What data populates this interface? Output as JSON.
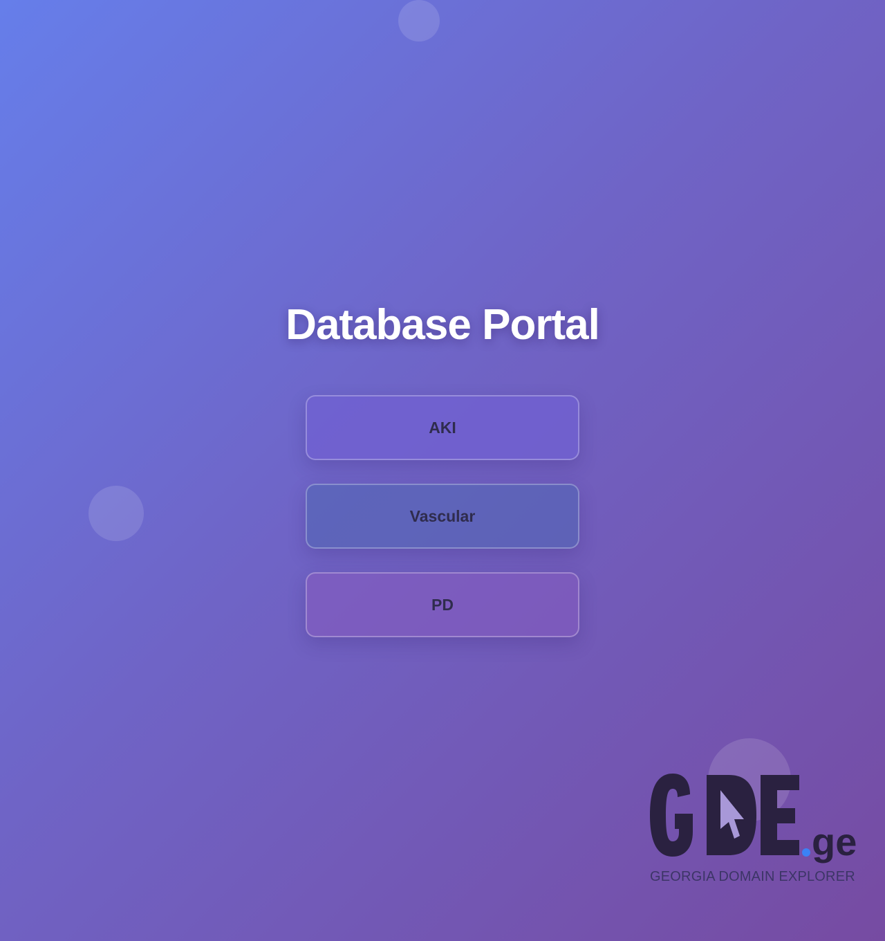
{
  "page": {
    "title": "Database Portal"
  },
  "buttons": [
    {
      "label": "AKI"
    },
    {
      "label": "Vascular"
    },
    {
      "label": "PD"
    }
  ],
  "logo": {
    "brand": "GDE",
    "suffix": "ge",
    "tagline": "GEORGIA DOMAIN EXPLORER"
  },
  "colors": {
    "background_start": "#667eea",
    "background_end": "#764ba2",
    "title": "#ffffff",
    "button_text": "#2f2c4d",
    "logo_dark": "#2a2140",
    "logo_dot": "#3b82f6"
  }
}
